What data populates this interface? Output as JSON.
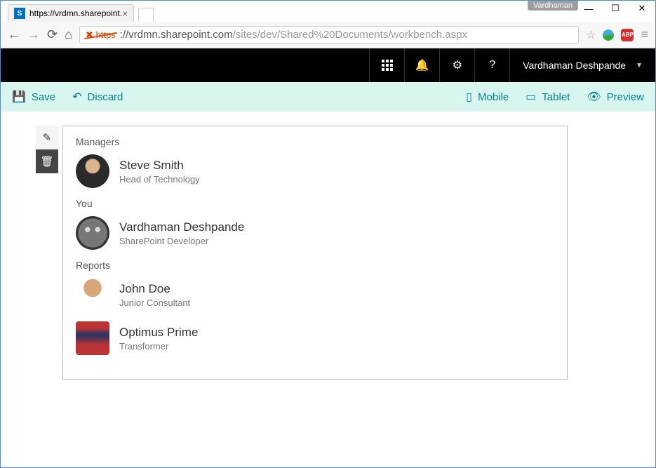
{
  "browser": {
    "profile_name": "Vardhaman",
    "tab_title": "https://vrdmn.sharepoint.",
    "url_scheme": "https",
    "url_host": "://vrdmn.sharepoint.com",
    "url_path": "/sites/dev/Shared%20Documents/workbench.aspx",
    "abp_label": "ABP"
  },
  "header": {
    "user_name": "Vardhaman Deshpande"
  },
  "toolbar": {
    "save": "Save",
    "discard": "Discard",
    "mobile": "Mobile",
    "tablet": "Tablet",
    "preview": "Preview"
  },
  "webpart": {
    "sections": [
      {
        "label": "Managers",
        "people": [
          {
            "name": "Steve Smith",
            "title": "Head of Technology",
            "avatar": "av1"
          }
        ]
      },
      {
        "label": "You",
        "people": [
          {
            "name": "Vardhaman Deshpande",
            "title": "SharePoint Developer",
            "avatar": "av2"
          }
        ]
      },
      {
        "label": "Reports",
        "people": [
          {
            "name": "John Doe",
            "title": "Junior Consultant",
            "avatar": "av3"
          },
          {
            "name": "Optimus Prime",
            "title": "Transformer",
            "avatar": "av4"
          }
        ]
      }
    ]
  }
}
